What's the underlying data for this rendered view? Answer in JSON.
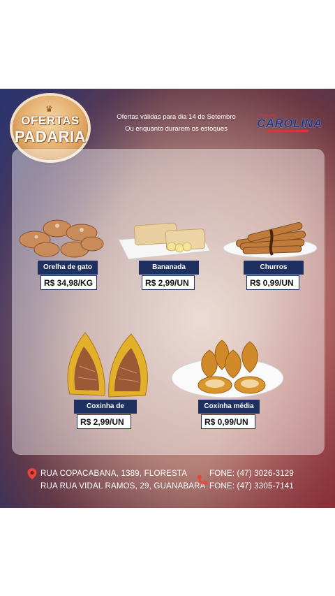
{
  "badge": {
    "line1": "OFERTAS",
    "line2": "PADARIA"
  },
  "validity": {
    "line1": "Ofertas válidas para dia 14 de Setembro",
    "line2": "Ou enquanto durarem os estoques"
  },
  "logo": {
    "small": "mercado",
    "name": "CAROLINA"
  },
  "products": [
    {
      "name": "Orelha de gato",
      "price": "R$ 34,98/KG"
    },
    {
      "name": "Bananada",
      "price": "R$ 2,99/UN"
    },
    {
      "name": "Churros",
      "price": "R$ 0,99/UN"
    },
    {
      "name": "Coxinha de costela",
      "price": "R$ 2,99/UN"
    },
    {
      "name": "Coxinha média",
      "price": "R$ 0,99/UN"
    }
  ],
  "addresses": [
    "RUA COPACABANA, 1389, FLORESTA",
    "RUA RUA VIDAL RAMOS, 29, GUANABARA"
  ],
  "phones": [
    "FONE: (47) 3026-3129",
    "FONE: (47) 3305-7141"
  ],
  "icons": [
    "location-pin-icon",
    "phone-icon",
    "crown-icon"
  ],
  "colors": {
    "label_bg": "#1e3060",
    "accent_red": "#d23a3a"
  }
}
